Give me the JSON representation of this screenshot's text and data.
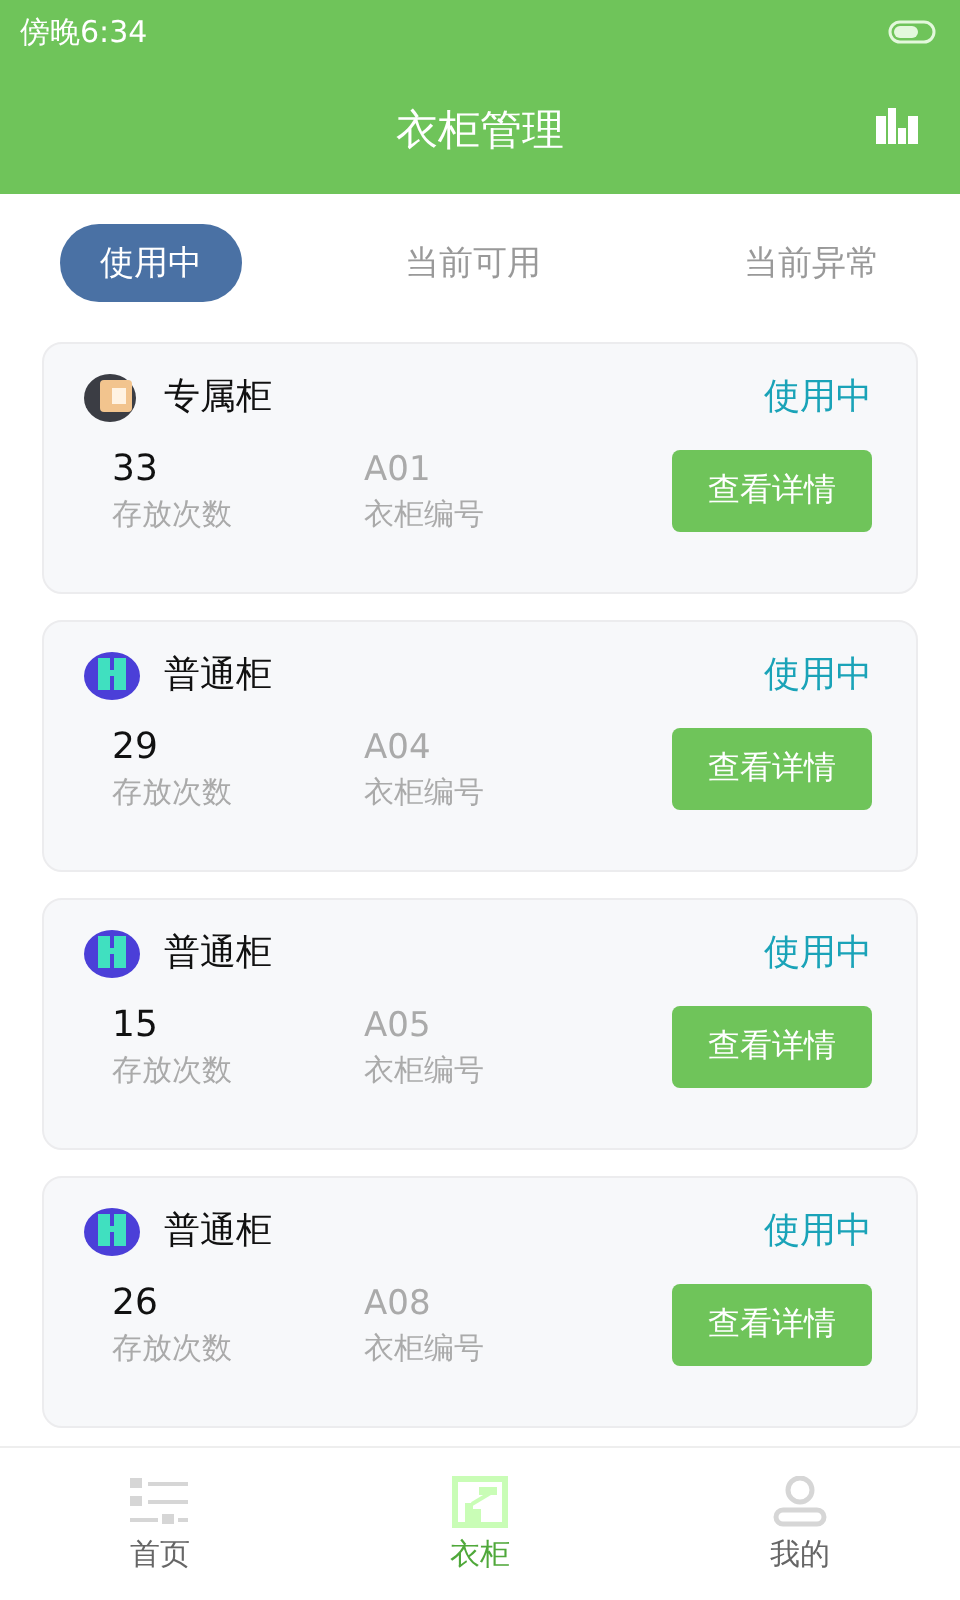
{
  "status_bar": {
    "time": "傍晚6:34"
  },
  "header": {
    "title": "衣柜管理"
  },
  "tabs": [
    {
      "label": "使用中",
      "selected": true
    },
    {
      "label": "当前可用",
      "selected": false
    },
    {
      "label": "当前异常",
      "selected": false
    }
  ],
  "cards": [
    {
      "kind": "exclusive",
      "name": "专属柜",
      "status": "使用中",
      "count": "33",
      "count_label": "存放次数",
      "code": "A01",
      "code_label": "衣柜编号",
      "button": "查看详情"
    },
    {
      "kind": "normal",
      "name": "普通柜",
      "status": "使用中",
      "count": "29",
      "count_label": "存放次数",
      "code": "A04",
      "code_label": "衣柜编号",
      "button": "查看详情"
    },
    {
      "kind": "normal",
      "name": "普通柜",
      "status": "使用中",
      "count": "15",
      "count_label": "存放次数",
      "code": "A05",
      "code_label": "衣柜编号",
      "button": "查看详情"
    },
    {
      "kind": "normal",
      "name": "普通柜",
      "status": "使用中",
      "count": "26",
      "count_label": "存放次数",
      "code": "A08",
      "code_label": "衣柜编号",
      "button": "查看详情"
    }
  ],
  "nav": [
    {
      "kind": "home",
      "label": "首页",
      "selected": false
    },
    {
      "kind": "wardrobe",
      "label": "衣柜",
      "selected": true
    },
    {
      "kind": "me",
      "label": "我的",
      "selected": false
    }
  ]
}
